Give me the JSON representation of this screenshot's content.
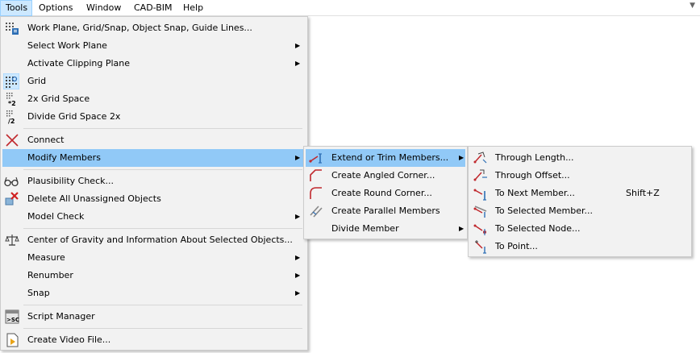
{
  "menubar": {
    "items": [
      "Tools",
      "Options",
      "Window",
      "CAD-BIM",
      "Help"
    ],
    "chevron": "chevron-down-icon"
  },
  "tools_menu": {
    "items": [
      {
        "label": "Work Plane, Grid/Snap, Object Snap, Guide Lines...",
        "icon": "grid-settings-icon"
      },
      {
        "label": "Select Work Plane"
      },
      {
        "label": "Activate Clipping Plane"
      },
      {
        "label": "Grid",
        "icon": "grid-icon"
      },
      {
        "label": "2x Grid Space",
        "icon": "grid-double-icon",
        "icon_text": "*2"
      },
      {
        "label": "Divide Grid Space 2x",
        "icon": "grid-divide-icon",
        "icon_text": "/2"
      },
      {
        "label": "Connect",
        "icon": "connect-icon"
      },
      {
        "label": "Modify Members"
      },
      {
        "label": "Plausibility Check...",
        "icon": "glasses-icon"
      },
      {
        "label": "Delete All Unassigned Objects",
        "icon": "delete-objects-icon"
      },
      {
        "label": "Model Check"
      },
      {
        "label": "Center of Gravity and Information About Selected Objects...",
        "icon": "balance-scale-icon"
      },
      {
        "label": "Measure"
      },
      {
        "label": "Renumber"
      },
      {
        "label": "Snap"
      },
      {
        "label": "Script Manager",
        "icon": "script-icon",
        "icon_text": ">SC"
      },
      {
        "label": "Create Video File...",
        "icon": "video-file-icon"
      }
    ]
  },
  "modify_members_menu": {
    "items": [
      {
        "label": "Extend or Trim Members...",
        "icon": "extend-trim-icon"
      },
      {
        "label": "Create Angled Corner...",
        "icon": "angled-corner-icon"
      },
      {
        "label": "Create Round Corner...",
        "icon": "round-corner-icon"
      },
      {
        "label": "Create Parallel Members",
        "icon": "parallel-members-icon"
      },
      {
        "label": "Divide Member"
      }
    ]
  },
  "extend_trim_menu": {
    "items": [
      {
        "label": "Through Length...",
        "icon": "through-length-icon"
      },
      {
        "label": "Through Offset...",
        "icon": "through-offset-icon"
      },
      {
        "label": "To Next Member...",
        "icon": "to-next-member-icon",
        "shortcut": "Shift+Z"
      },
      {
        "label": "To Selected Member...",
        "icon": "to-selected-member-icon"
      },
      {
        "label": "To Selected Node...",
        "icon": "to-selected-node-icon"
      },
      {
        "label": "To Point...",
        "icon": "to-point-icon"
      }
    ]
  },
  "colors": {
    "highlight": "#91c9f7",
    "menubar_active": "#cce8ff",
    "icon_red": "#c0282d",
    "icon_blue": "#2e6fb5"
  }
}
